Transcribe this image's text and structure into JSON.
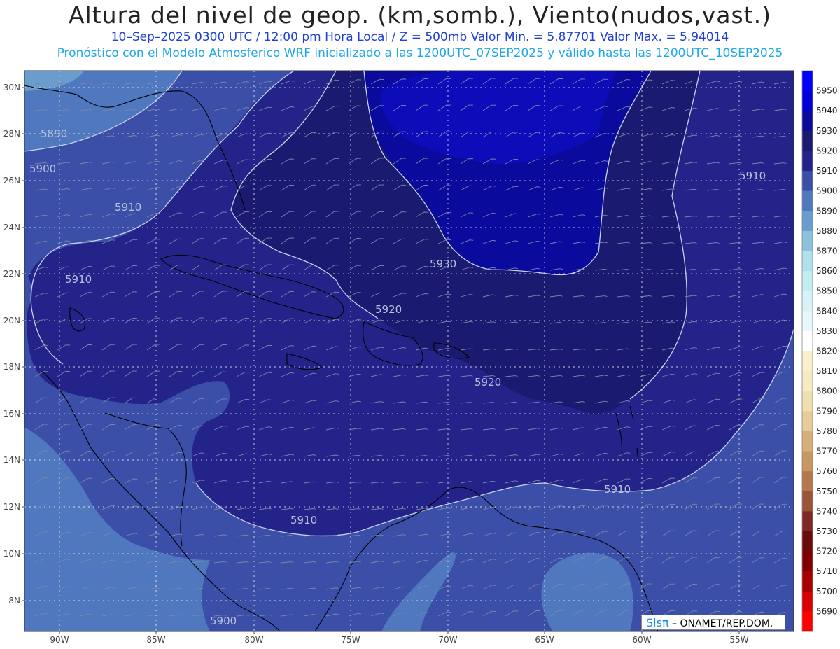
{
  "header": {
    "title": "Altura del nivel de geop. (km,somb.), Viento(nudos,vast.)",
    "subtitle": "10–Sep–2025  0300 UTC / 12:00 pm Hora Local / Z = 500mb    Valor Min. = 5.87701  Valor Max. = 5.94014",
    "info": "Pronóstico con el Modelo Atmosferico WRF inicializado a las 1200UTC_07SEP2025 y válido hasta las  1200UTC_10SEP2025"
  },
  "axes": {
    "lon_labels": [
      "90W",
      "85W",
      "80W",
      "75W",
      "70W",
      "65W",
      "60W",
      "55W"
    ],
    "lat_labels": [
      "8N",
      "10N",
      "12N",
      "14N",
      "16N",
      "18N",
      "20N",
      "22N",
      "24N",
      "26N",
      "28N",
      "30N"
    ]
  },
  "contour_labels": [
    "5890",
    "5900",
    "5910",
    "5910",
    "5910",
    "5930",
    "5920",
    "5920",
    "5910",
    "5910",
    "5900"
  ],
  "colorbar": {
    "levels": [
      5950,
      5940,
      5930,
      5920,
      5910,
      5900,
      5890,
      5880,
      5870,
      5860,
      5850,
      5840,
      5830,
      5820,
      5810,
      5800,
      5790,
      5780,
      5770,
      5760,
      5750,
      5740,
      5730,
      5720,
      5710,
      5700,
      5690
    ],
    "colors": [
      "#0000ff",
      "#0000d8",
      "#0a0a9c",
      "#1a1a70",
      "#23238a",
      "#3b4fa8",
      "#4f78be",
      "#6a9ccd",
      "#8cc1dc",
      "#b0e0ec",
      "#c4ecf3",
      "#d8f3f8",
      "#e6f8fb",
      "#ffffff",
      "#faf1cc",
      "#f7eac0",
      "#f0dfb0",
      "#e7cb98",
      "#d8ae78",
      "#c89860",
      "#b5774c",
      "#9a5538",
      "#7e2828",
      "#6b0c0c",
      "#800000",
      "#a80000",
      "#d80000",
      "#ff0000"
    ]
  },
  "credit": {
    "logo": "Sisπ",
    "text": " – ONAMET/REP.DOM."
  }
}
